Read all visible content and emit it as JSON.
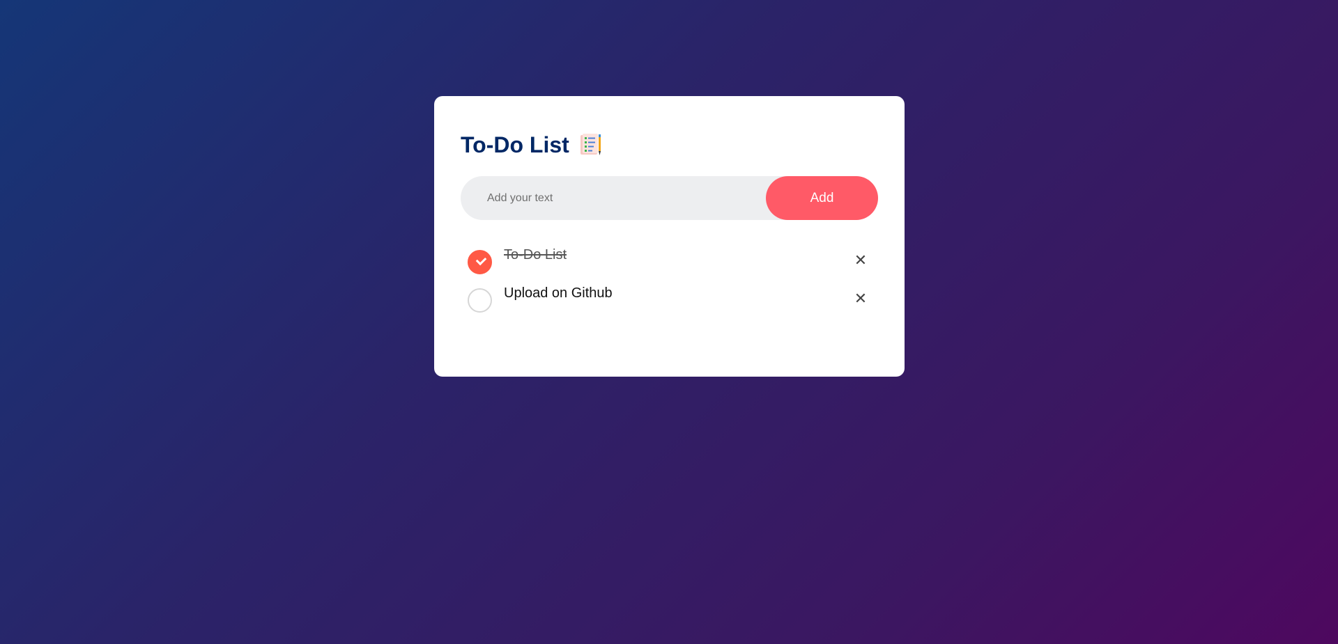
{
  "header": {
    "title": "To-Do List",
    "icon": "notepad-icon"
  },
  "input": {
    "value": "",
    "placeholder": "Add your text",
    "add_label": "Add"
  },
  "tasks": [
    {
      "text": "To-Do List",
      "checked": true,
      "delete_glyph": "✕"
    },
    {
      "text": "Upload on Github",
      "checked": false,
      "delete_glyph": "✕"
    }
  ],
  "colors": {
    "accent": "#ff5a67",
    "check": "#ff5945",
    "title": "#002765"
  }
}
